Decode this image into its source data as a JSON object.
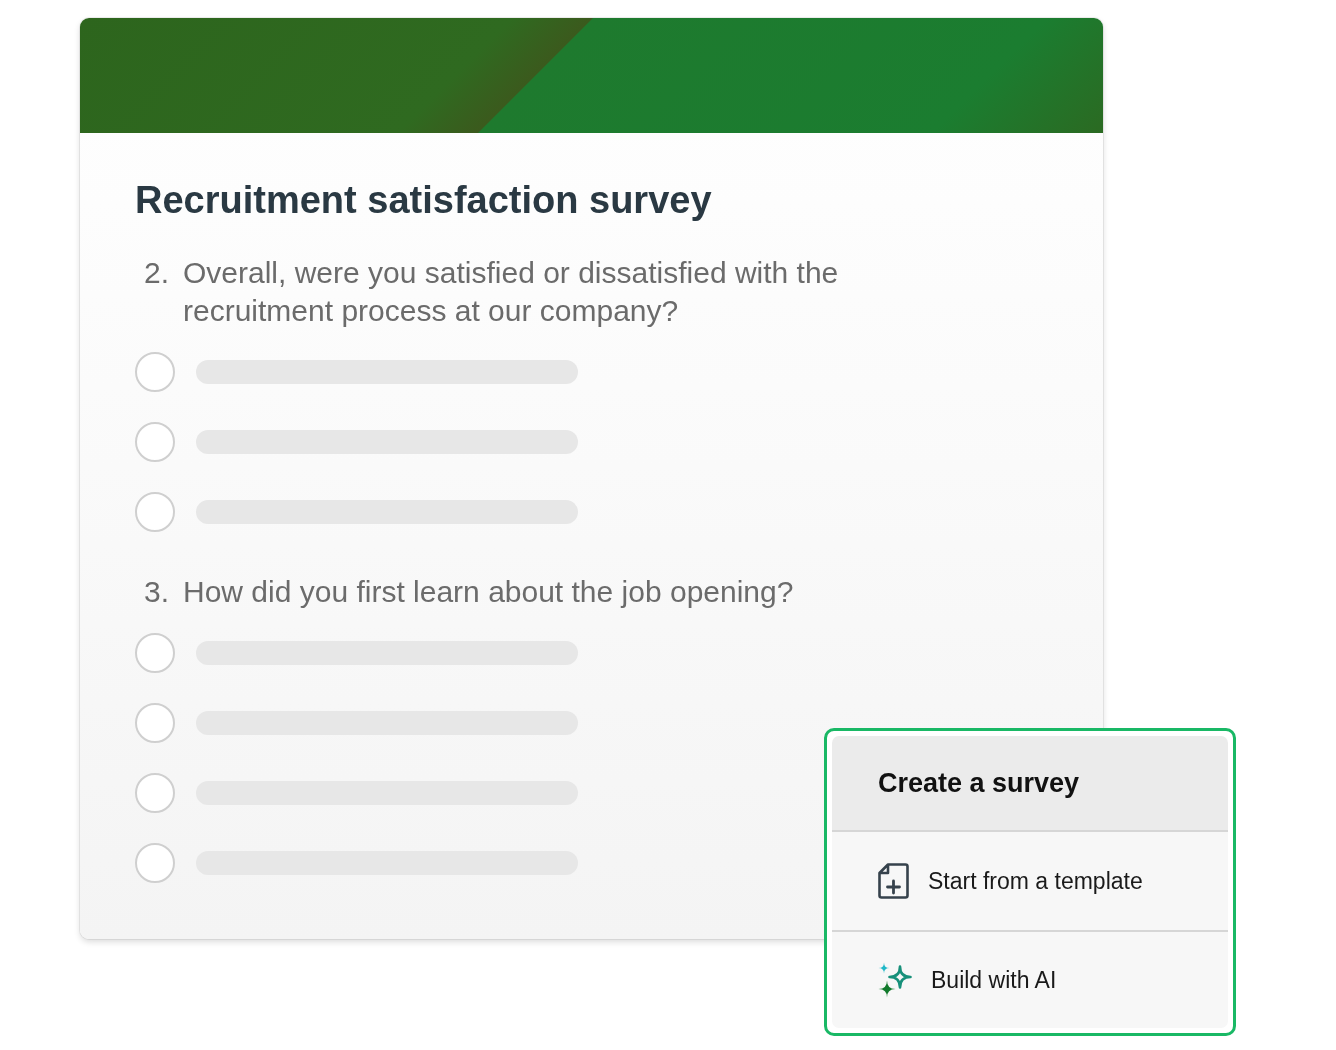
{
  "survey": {
    "title": "Recruitment satisfaction survey",
    "questions": [
      {
        "number": "2.",
        "text": "Overall, were you satisfied or dissatisfied with the recruitment process at our company?",
        "options": [
          {
            "selected": false
          },
          {
            "selected": false
          },
          {
            "selected": false
          }
        ]
      },
      {
        "number": "3.",
        "text": "How did you first learn about the job opening?",
        "options": [
          {
            "selected": false
          },
          {
            "selected": false
          },
          {
            "selected": false
          },
          {
            "selected": false
          }
        ]
      }
    ]
  },
  "create_menu": {
    "title": "Create a survey",
    "items": [
      {
        "kind": "template",
        "label": "Start from a template"
      },
      {
        "kind": "ai",
        "label": "Build with AI"
      }
    ]
  }
}
